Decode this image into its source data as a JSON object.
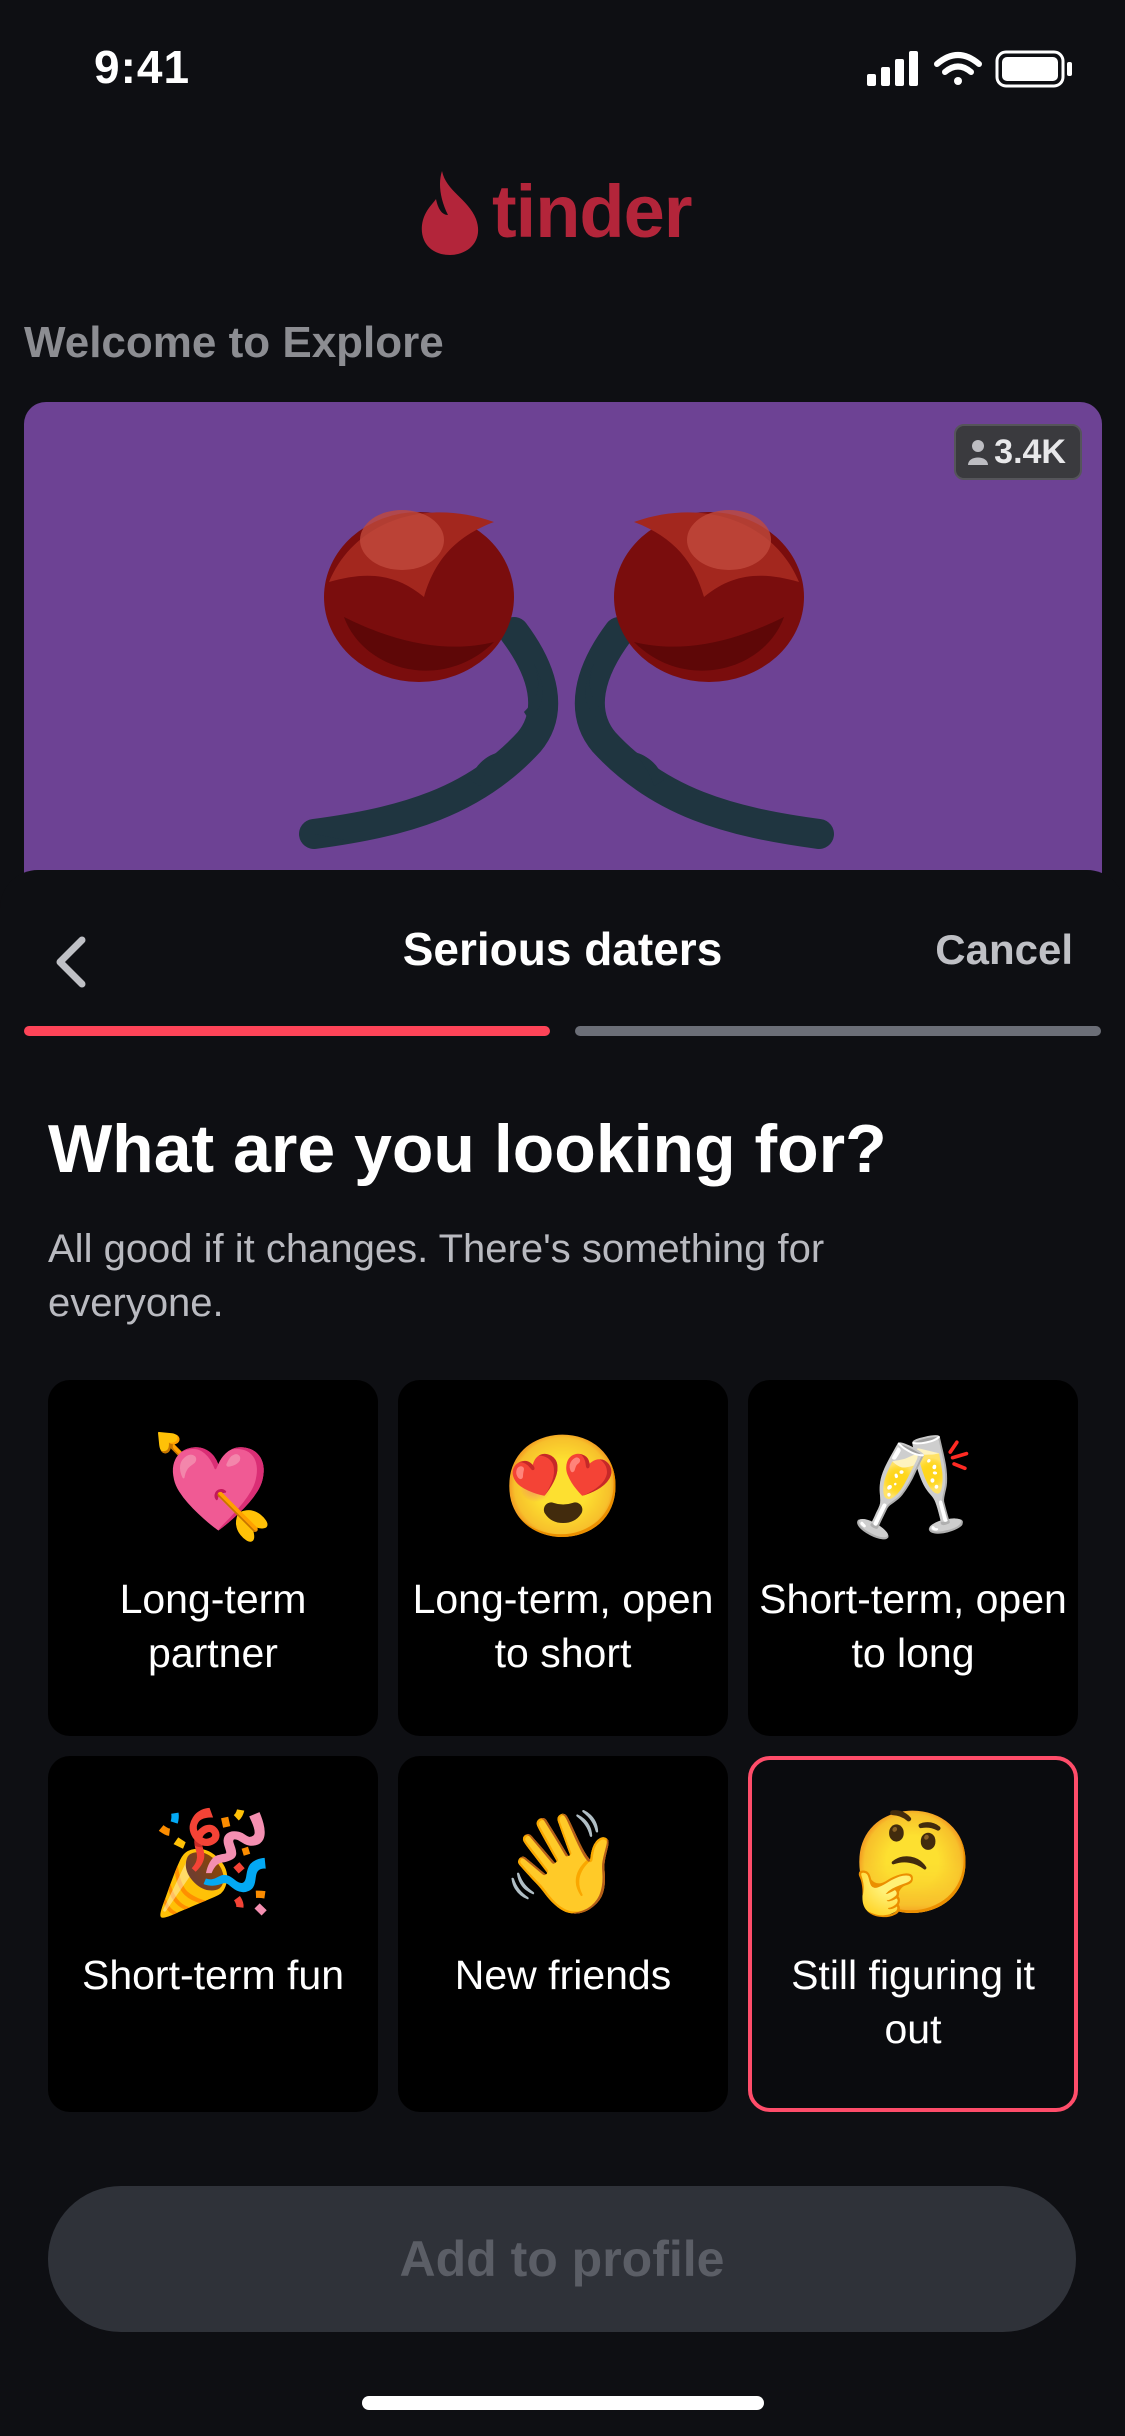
{
  "status_bar": {
    "time": "9:41"
  },
  "app": {
    "logo_text": "tinder",
    "brand_color": "#b3253a"
  },
  "explore": {
    "title": "Welcome to Explore",
    "member_count": "3.4K"
  },
  "sheet": {
    "title": "Serious daters",
    "cancel_label": "Cancel",
    "progress": {
      "step": 1,
      "total": 2
    },
    "heading": "What are you looking for?",
    "subheading": "All good if it changes. There's something for everyone."
  },
  "options": [
    {
      "emoji": "💘",
      "label": "Long-term partner",
      "selected": false
    },
    {
      "emoji": "😍",
      "label": "Long-term, open to short",
      "selected": false
    },
    {
      "emoji": "🥂",
      "label": "Short-term, open to long",
      "selected": false
    },
    {
      "emoji": "🎉",
      "label": "Short-term fun",
      "selected": false
    },
    {
      "emoji": "👋",
      "label": "New friends",
      "selected": false
    },
    {
      "emoji": "🤔",
      "label": "Still figuring it out",
      "selected": true
    }
  ],
  "footer": {
    "add_button_label": "Add to profile"
  },
  "colors": {
    "accent": "#fe4458",
    "background": "#0e0f13",
    "hero_bg": "#6d4294"
  }
}
